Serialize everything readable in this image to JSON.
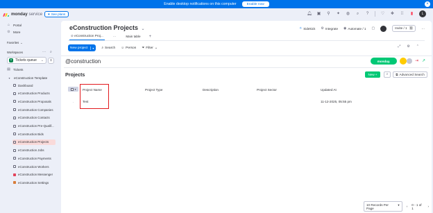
{
  "notification": {
    "text": "Enable desktop notifications on this computer",
    "button": "Enable now"
  },
  "topbar": {
    "brand_name": "monday",
    "brand_suffix": "service",
    "see_plans": "See plans",
    "avatar_initial": "L"
  },
  "sidebar": {
    "portal": "Portal",
    "more": "More",
    "favorites": "Favorites",
    "workspaces": "Workspaces",
    "workspace_name": "Tickets queue",
    "workspace_badge": "T",
    "tickets": "Tickets",
    "template_folder": "eConstruction Template",
    "boards": [
      {
        "label": "Dashboard",
        "icon": "dashboard-icon"
      },
      {
        "label": "eConstruction Products",
        "icon": "board-icon"
      },
      {
        "label": "eConstruction Proposals",
        "icon": "board-icon"
      },
      {
        "label": "eConstruction Companies",
        "icon": "board-icon"
      },
      {
        "label": "eConstruction Contacts",
        "icon": "board-icon"
      },
      {
        "label": "eConstruction Pre-Qualif...",
        "icon": "board-icon"
      },
      {
        "label": "eConstruction Bids",
        "icon": "board-icon"
      },
      {
        "label": "eConstruction Projects",
        "icon": "board-icon"
      },
      {
        "label": "eConstruction Jobs",
        "icon": "board-icon"
      },
      {
        "label": "eConstruction Payments",
        "icon": "board-icon"
      },
      {
        "label": "eConstruction Workers",
        "icon": "board-icon"
      },
      {
        "label": "eConstruction Messenger",
        "icon": "doc-icon"
      },
      {
        "label": "eConstruction Settings",
        "icon": "settings-icon"
      }
    ],
    "active_board": "eConstruction Projects"
  },
  "board": {
    "title": "eConstruction Projects",
    "sidekick": "Sidekick",
    "integrate": "Integrate",
    "automate": "Automate / 1",
    "invite": "Invite / 1",
    "tabs": [
      {
        "label": "eConstruction Proj..."
      },
      {
        "label": "Main table"
      }
    ],
    "new_item": "New project",
    "search": "Search",
    "person": "Person",
    "filter": "Filter"
  },
  "app": {
    "logo_prefix": "@",
    "logo_text": "construction",
    "monday_badge": "monday.",
    "section_title": "Projects",
    "new_button": "New",
    "advanced_search": "Advanced Search",
    "columns": [
      "Project Name",
      "Project Type",
      "Description",
      "Project Sector",
      "Updated At"
    ],
    "rows": [
      {
        "project_name": "Test",
        "project_type": "",
        "description": "",
        "project_sector": "",
        "updated_at": "11-12-2025, 05:55 pm"
      }
    ],
    "records_per_page": "10 Records Per Page",
    "pagination": "0 - 1 of 1"
  },
  "colors": {
    "primary": "#0073ea",
    "success": "#00c875",
    "highlight": "#e2191d"
  }
}
